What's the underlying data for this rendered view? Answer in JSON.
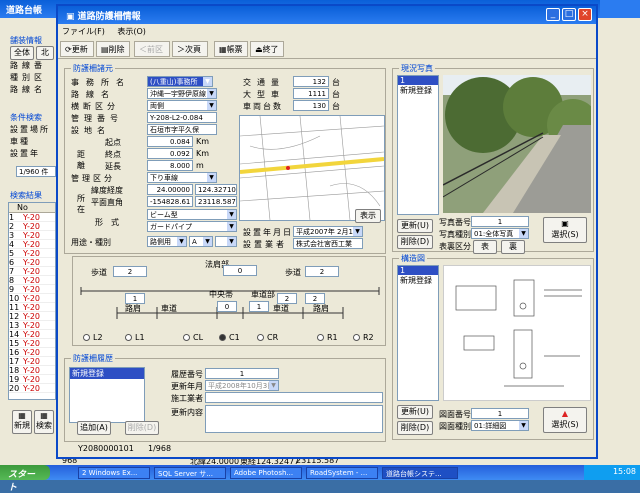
{
  "bg": {
    "title": "道路台帳",
    "section1": "舗装情報",
    "tabs": [
      "全体",
      "北"
    ],
    "side_labels": [
      "路",
      "線",
      "番",
      "種",
      "別",
      "区",
      "路",
      "線",
      "名"
    ],
    "section2": "条件検索",
    "cond_labels": [
      "設",
      "置",
      "場",
      "所",
      "車",
      "種",
      "設",
      "置",
      "年"
    ],
    "count": "1/960 件",
    "section3": "検索結果",
    "col_no": "No",
    "rows": [
      "1",
      "2",
      "3",
      "4",
      "5",
      "6",
      "7",
      "8",
      "9",
      "10",
      "11",
      "12",
      "13",
      "14",
      "15",
      "16",
      "17",
      "18",
      "19",
      "20"
    ],
    "row_prefix": "Y-20",
    "btn_new": "新規",
    "btn_search": "検索",
    "status": "968",
    "coord": "北緯24.0000",
    "coord2": "東経124.32477",
    "coord3": "23115.587"
  },
  "win": {
    "title": "道路防護柵情報",
    "menu": [
      "ファイル(F)",
      "表示(O)"
    ],
    "toolbar": [
      "更新",
      "削除",
      "＜前区",
      "＞次頁",
      "帳票",
      "終了"
    ],
    "basic": {
      "legend": "防護柵諸元",
      "labels": [
        "事務所名",
        "路線名",
        "横断区分",
        "管理番号",
        "設地名",
        "起点",
        "終点",
        "延長",
        "管理区分",
        "緯度経度",
        "平面直角",
        "形式",
        "用途・種別"
      ],
      "office": "(八重山)事務所",
      "route": "沖縄一宇野伊原線",
      "cross": "両側",
      "mgmt_no": "Y-208-L2-0.084",
      "place": "石垣市字平久保",
      "start": "0.084",
      "start_unit": "Km",
      "end": "0.092",
      "end_unit": "Km",
      "length": "8.000",
      "length_unit": "m",
      "mgmt_cls": "下り車線",
      "latlon_a": "24.00000",
      "latlon_b": "124.32710",
      "plane_a": "-154828.61",
      "plane_b": "23118.587",
      "type1": "ビーム型",
      "type2": "ガードパイプ",
      "use": "路側用",
      "kind1": "A",
      "kind2": "",
      "traffic_lbl": "交通量",
      "traffic": "132",
      "traffic_unit": "台",
      "large_lbl": "大型車",
      "large": "1111",
      "large_unit": "台",
      "cars_lbl": "車両台数",
      "cars": "130",
      "cars_unit": "台",
      "install_lbl": "設置年月日",
      "install": "平成2007年 2月15日",
      "vendor_lbl": "設置業者",
      "vendor": "株式会社宮西工業",
      "map_btn": "表示"
    },
    "diagram": {
      "left_lbl": "歩道",
      "left_val": "2",
      "mid_lbl": "法肩部",
      "mid_val": "0",
      "right_lbl": "歩道",
      "right_val": "2",
      "lane_lbl": "路肩",
      "lane2_lbl": "車道",
      "lane3_lbl": "中央帯",
      "lane4_lbl": "車道部",
      "lane5_lbl": "車道",
      "lane6_lbl": "路肩",
      "v1": "1",
      "v2": "2",
      "v3": "0",
      "v4": "1",
      "v5": "2",
      "radios": [
        "L2",
        "L1",
        "CL",
        "C1",
        "CR",
        "R1",
        "R2"
      ]
    },
    "history": {
      "legend": "防護柵履歴",
      "item": "新規登録",
      "labels": [
        "履歴番号",
        "更新年月",
        "施工業者",
        "更新内容"
      ],
      "number": "1",
      "date": "平成2008年10月3日",
      "add": "追加(A)",
      "del": "削除(D)"
    },
    "photo": {
      "legend": "現況写真",
      "items": [
        "1",
        "新規登録"
      ],
      "update": "更新(U)",
      "delete": "削除(D)",
      "no_lbl": "写真番号",
      "no": "1",
      "kind_lbl": "写真種別",
      "kind": "01:全体写真",
      "side_lbl": "表裏区分",
      "front": "表",
      "back": "裏",
      "select": "選択(S)"
    },
    "drawing": {
      "legend": "構造図",
      "items": [
        "1",
        "新規登録"
      ],
      "update": "更新(U)",
      "delete": "削除(D)",
      "no_lbl": "図面番号",
      "no": "1",
      "kind_lbl": "図面種別",
      "kind": "01:詳細図",
      "select": "選択(S)"
    },
    "status": {
      "id": "Y2080000101",
      "count": "1/968"
    }
  },
  "taskbar": {
    "start": "スタート",
    "tasks": [
      "2 Windows Ex...",
      "SQL Server サ...",
      "Adobe Photosh...",
      "RoadSystem - ...",
      "道路台帳システ..."
    ],
    "time": "15:08"
  }
}
